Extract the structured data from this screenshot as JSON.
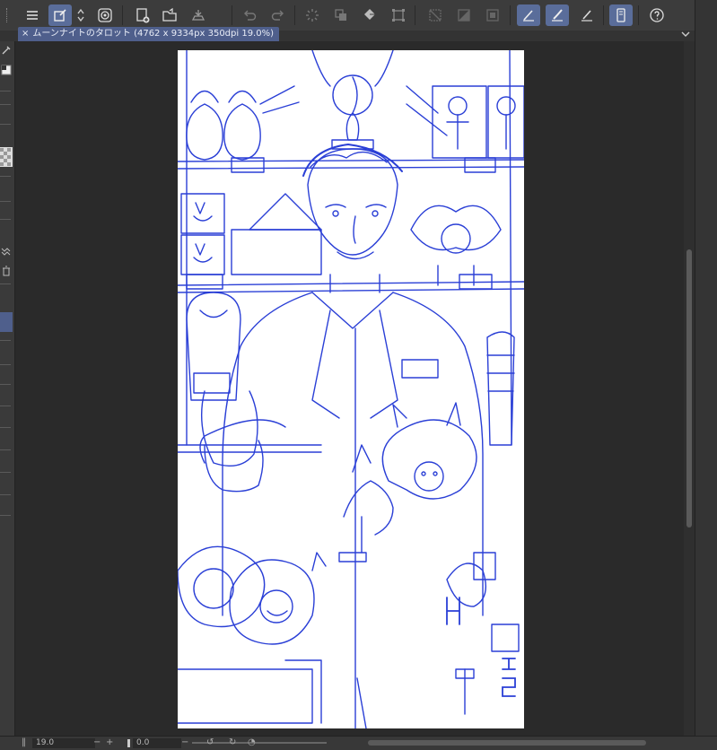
{
  "document": {
    "tab_title": "ムーンナイトのタロット (4762 x 9334px 350dpi 19.0%)",
    "close_glyph": "×"
  },
  "toolbar": {
    "icons": [
      "menu-icon",
      "layer-property-icon",
      "up-down-icon",
      "spiral-icon",
      "new-icon",
      "open-icon",
      "save-icon",
      "undo-icon",
      "redo-icon",
      "loading-icon",
      "copy-icon",
      "fill-icon",
      "transform-icon",
      "clear-outside-icon",
      "invert-icon",
      "selection-icon",
      "pen-tool-icon",
      "brush-tool-icon",
      "eraser-tool-icon",
      "device-icon",
      "help-icon"
    ]
  },
  "bottom": {
    "zoom_value": "19.0",
    "rotation_value": "0.0",
    "minus_glyph": "−",
    "plus_glyph": "+"
  },
  "colors": {
    "sketch": "#2a3fd6",
    "active": "#5a6d9a",
    "tab": "#4f5f8c"
  }
}
